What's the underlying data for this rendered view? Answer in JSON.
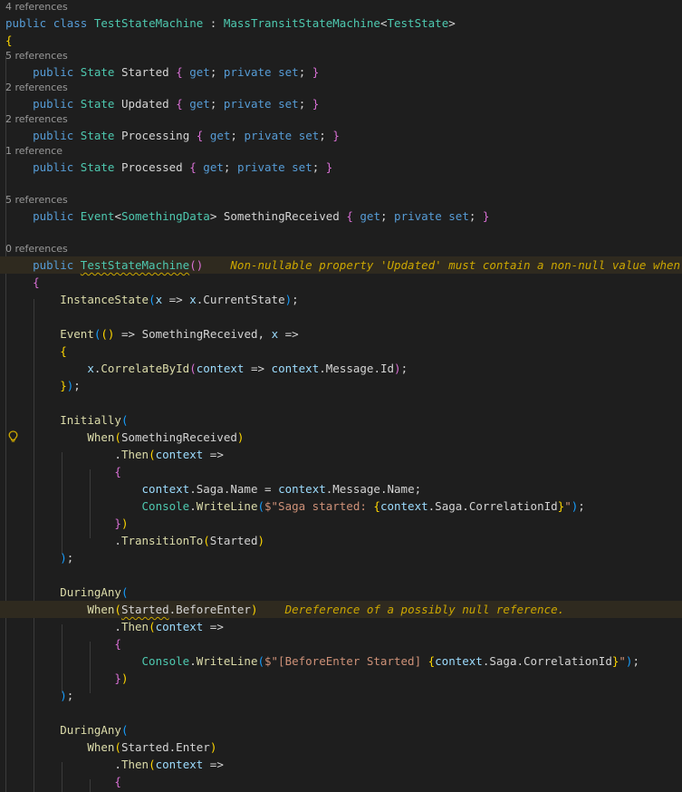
{
  "colors": {
    "keyword": "#569cd6",
    "type": "#4ec9b0",
    "function": "#dcdcaa",
    "variable": "#9cdcfe",
    "control": "#c586c0",
    "string": "#ce9178",
    "default": "#d4d4d4",
    "bracket_gold": "#ffd700",
    "bracket_purple": "#da70d6",
    "bracket_blue": "#179fff",
    "lens": "#999999",
    "warning_text": "#cca700"
  },
  "lightbulb_icon": "lightbulb-icon",
  "lines": [
    {
      "kind": "lens",
      "text": "4 references"
    },
    {
      "kind": "code",
      "tokens": [
        [
          "public",
          "keyword"
        ],
        [
          " ",
          "default"
        ],
        [
          "class",
          "keyword"
        ],
        [
          " ",
          "default"
        ],
        [
          "TestStateMachine",
          "type"
        ],
        [
          " : ",
          "default"
        ],
        [
          "MassTransitStateMachine",
          "type"
        ],
        [
          "<",
          "default"
        ],
        [
          "TestState",
          "type"
        ],
        [
          ">",
          "default"
        ]
      ]
    },
    {
      "kind": "code",
      "tokens": [
        [
          "{",
          "bracket_gold"
        ]
      ]
    },
    {
      "kind": "lens",
      "text": "5 references"
    },
    {
      "kind": "code",
      "tokens": [
        [
          "    ",
          "default"
        ],
        [
          "public",
          "keyword"
        ],
        [
          " ",
          "default"
        ],
        [
          "State",
          "type"
        ],
        [
          " ",
          "default"
        ],
        [
          "Started",
          "default"
        ],
        [
          " ",
          "default"
        ],
        [
          "{",
          "bracket_purple"
        ],
        [
          " ",
          "default"
        ],
        [
          "get",
          "keyword"
        ],
        [
          "; ",
          "default"
        ],
        [
          "private",
          "keyword"
        ],
        [
          " ",
          "default"
        ],
        [
          "set",
          "keyword"
        ],
        [
          "; ",
          "default"
        ],
        [
          "}",
          "bracket_purple"
        ]
      ]
    },
    {
      "kind": "lens",
      "text": "2 references"
    },
    {
      "kind": "code",
      "tokens": [
        [
          "    ",
          "default"
        ],
        [
          "public",
          "keyword"
        ],
        [
          " ",
          "default"
        ],
        [
          "State",
          "type"
        ],
        [
          " ",
          "default"
        ],
        [
          "Updated",
          "default"
        ],
        [
          " ",
          "default"
        ],
        [
          "{",
          "bracket_purple"
        ],
        [
          " ",
          "default"
        ],
        [
          "get",
          "keyword"
        ],
        [
          "; ",
          "default"
        ],
        [
          "private",
          "keyword"
        ],
        [
          " ",
          "default"
        ],
        [
          "set",
          "keyword"
        ],
        [
          "; ",
          "default"
        ],
        [
          "}",
          "bracket_purple"
        ]
      ]
    },
    {
      "kind": "lens",
      "text": "2 references"
    },
    {
      "kind": "code",
      "tokens": [
        [
          "    ",
          "default"
        ],
        [
          "public",
          "keyword"
        ],
        [
          " ",
          "default"
        ],
        [
          "State",
          "type"
        ],
        [
          " ",
          "default"
        ],
        [
          "Processing",
          "default"
        ],
        [
          " ",
          "default"
        ],
        [
          "{",
          "bracket_purple"
        ],
        [
          " ",
          "default"
        ],
        [
          "get",
          "keyword"
        ],
        [
          "; ",
          "default"
        ],
        [
          "private",
          "keyword"
        ],
        [
          " ",
          "default"
        ],
        [
          "set",
          "keyword"
        ],
        [
          "; ",
          "default"
        ],
        [
          "}",
          "bracket_purple"
        ]
      ]
    },
    {
      "kind": "lens",
      "text": "1 reference"
    },
    {
      "kind": "code",
      "tokens": [
        [
          "    ",
          "default"
        ],
        [
          "public",
          "keyword"
        ],
        [
          " ",
          "default"
        ],
        [
          "State",
          "type"
        ],
        [
          " ",
          "default"
        ],
        [
          "Processed",
          "default"
        ],
        [
          " ",
          "default"
        ],
        [
          "{",
          "bracket_purple"
        ],
        [
          " ",
          "default"
        ],
        [
          "get",
          "keyword"
        ],
        [
          "; ",
          "default"
        ],
        [
          "private",
          "keyword"
        ],
        [
          " ",
          "default"
        ],
        [
          "set",
          "keyword"
        ],
        [
          "; ",
          "default"
        ],
        [
          "}",
          "bracket_purple"
        ]
      ]
    },
    {
      "kind": "blank"
    },
    {
      "kind": "lens",
      "text": "5 references"
    },
    {
      "kind": "code",
      "tokens": [
        [
          "    ",
          "default"
        ],
        [
          "public",
          "keyword"
        ],
        [
          " ",
          "default"
        ],
        [
          "Event",
          "type"
        ],
        [
          "<",
          "default"
        ],
        [
          "SomethingData",
          "type"
        ],
        [
          "> ",
          "default"
        ],
        [
          "SomethingReceived",
          "default"
        ],
        [
          " ",
          "default"
        ],
        [
          "{",
          "bracket_purple"
        ],
        [
          " ",
          "default"
        ],
        [
          "get",
          "keyword"
        ],
        [
          "; ",
          "default"
        ],
        [
          "private",
          "keyword"
        ],
        [
          " ",
          "default"
        ],
        [
          "set",
          "keyword"
        ],
        [
          "; ",
          "default"
        ],
        [
          "}",
          "bracket_purple"
        ]
      ]
    },
    {
      "kind": "blank"
    },
    {
      "kind": "lens",
      "text": "0 references"
    },
    {
      "kind": "code",
      "warn": true,
      "tokens": [
        [
          "    ",
          "default"
        ],
        [
          "public",
          "keyword"
        ],
        [
          " ",
          "default"
        ],
        [
          "TestStateMachine",
          "type",
          "squiggle"
        ],
        [
          "()",
          "bracket_purple"
        ],
        [
          "    ",
          "default"
        ],
        [
          "Non-nullable property 'Updated' must contain a non-null value when exiting constructor. Consider declaring the property as nullable.",
          "warning_text",
          "inlay"
        ]
      ]
    },
    {
      "kind": "code",
      "tokens": [
        [
          "    ",
          "default"
        ],
        [
          "{",
          "bracket_purple"
        ]
      ]
    },
    {
      "kind": "code",
      "tokens": [
        [
          "        ",
          "default"
        ],
        [
          "InstanceState",
          "function"
        ],
        [
          "(",
          "bracket_blue"
        ],
        [
          "x",
          "variable"
        ],
        [
          " => ",
          "default"
        ],
        [
          "x",
          "variable"
        ],
        [
          ".",
          "default"
        ],
        [
          "CurrentState",
          "default"
        ],
        [
          ")",
          "bracket_blue"
        ],
        [
          ";",
          "default"
        ]
      ]
    },
    {
      "kind": "blank"
    },
    {
      "kind": "code",
      "tokens": [
        [
          "        ",
          "default"
        ],
        [
          "Event",
          "function"
        ],
        [
          "(",
          "bracket_blue"
        ],
        [
          "()",
          "bracket_gold"
        ],
        [
          " => ",
          "default"
        ],
        [
          "SomethingReceived",
          "default"
        ],
        [
          ", ",
          "default"
        ],
        [
          "x",
          "variable"
        ],
        [
          " =>",
          "default"
        ]
      ]
    },
    {
      "kind": "code",
      "tokens": [
        [
          "        ",
          "default"
        ],
        [
          "{",
          "bracket_gold"
        ]
      ]
    },
    {
      "kind": "code",
      "tokens": [
        [
          "            ",
          "default"
        ],
        [
          "x",
          "variable"
        ],
        [
          ".",
          "default"
        ],
        [
          "CorrelateById",
          "function"
        ],
        [
          "(",
          "bracket_purple"
        ],
        [
          "context",
          "variable"
        ],
        [
          " => ",
          "default"
        ],
        [
          "context",
          "variable"
        ],
        [
          ".",
          "default"
        ],
        [
          "Message",
          "default"
        ],
        [
          ".",
          "default"
        ],
        [
          "Id",
          "default"
        ],
        [
          ")",
          "bracket_purple"
        ],
        [
          ";",
          "default"
        ]
      ]
    },
    {
      "kind": "code",
      "tokens": [
        [
          "        ",
          "default"
        ],
        [
          "}",
          "bracket_gold"
        ],
        [
          ")",
          "bracket_blue"
        ],
        [
          ";",
          "default"
        ]
      ]
    },
    {
      "kind": "blank"
    },
    {
      "kind": "code",
      "tokens": [
        [
          "        ",
          "default"
        ],
        [
          "Initially",
          "function"
        ],
        [
          "(",
          "bracket_blue"
        ]
      ]
    },
    {
      "kind": "code",
      "bulb": true,
      "tokens": [
        [
          "            ",
          "default"
        ],
        [
          "When",
          "function"
        ],
        [
          "(",
          "bracket_gold"
        ],
        [
          "SomethingReceived",
          "default"
        ],
        [
          ")",
          "bracket_gold"
        ]
      ]
    },
    {
      "kind": "code",
      "tokens": [
        [
          "                ",
          "default"
        ],
        [
          ".",
          "default"
        ],
        [
          "Then",
          "function"
        ],
        [
          "(",
          "bracket_gold"
        ],
        [
          "context",
          "variable"
        ],
        [
          " =>",
          "default"
        ]
      ]
    },
    {
      "kind": "code",
      "tokens": [
        [
          "                ",
          "default"
        ],
        [
          "{",
          "bracket_purple"
        ]
      ]
    },
    {
      "kind": "code",
      "tokens": [
        [
          "                    ",
          "default"
        ],
        [
          "context",
          "variable"
        ],
        [
          ".",
          "default"
        ],
        [
          "Saga",
          "default"
        ],
        [
          ".",
          "default"
        ],
        [
          "Name",
          "default"
        ],
        [
          " = ",
          "default"
        ],
        [
          "context",
          "variable"
        ],
        [
          ".",
          "default"
        ],
        [
          "Message",
          "default"
        ],
        [
          ".",
          "default"
        ],
        [
          "Name",
          "default"
        ],
        [
          ";",
          "default"
        ]
      ]
    },
    {
      "kind": "code",
      "tokens": [
        [
          "                    ",
          "default"
        ],
        [
          "Console",
          "type"
        ],
        [
          ".",
          "default"
        ],
        [
          "WriteLine",
          "function"
        ],
        [
          "(",
          "bracket_blue"
        ],
        [
          "$\"Saga started: ",
          "string"
        ],
        [
          "{",
          "bracket_gold"
        ],
        [
          "context",
          "variable"
        ],
        [
          ".",
          "default"
        ],
        [
          "Saga",
          "default"
        ],
        [
          ".",
          "default"
        ],
        [
          "CorrelationId",
          "default"
        ],
        [
          "}",
          "bracket_gold"
        ],
        [
          "\"",
          "string"
        ],
        [
          ")",
          "bracket_blue"
        ],
        [
          ";",
          "default"
        ]
      ]
    },
    {
      "kind": "code",
      "tokens": [
        [
          "                ",
          "default"
        ],
        [
          "}",
          "bracket_purple"
        ],
        [
          ")",
          "bracket_gold"
        ]
      ]
    },
    {
      "kind": "code",
      "tokens": [
        [
          "                ",
          "default"
        ],
        [
          ".",
          "default"
        ],
        [
          "TransitionTo",
          "function"
        ],
        [
          "(",
          "bracket_gold"
        ],
        [
          "Started",
          "default"
        ],
        [
          ")",
          "bracket_gold"
        ]
      ]
    },
    {
      "kind": "code",
      "tokens": [
        [
          "        ",
          "default"
        ],
        [
          ")",
          "bracket_blue"
        ],
        [
          ";",
          "default"
        ]
      ]
    },
    {
      "kind": "blank"
    },
    {
      "kind": "code",
      "tokens": [
        [
          "        ",
          "default"
        ],
        [
          "DuringAny",
          "function"
        ],
        [
          "(",
          "bracket_blue"
        ]
      ]
    },
    {
      "kind": "code",
      "warn": true,
      "tokens": [
        [
          "            ",
          "default"
        ],
        [
          "When",
          "function"
        ],
        [
          "(",
          "bracket_gold"
        ],
        [
          "Started",
          "default",
          "squiggle"
        ],
        [
          ".",
          "default"
        ],
        [
          "BeforeEnter",
          "default"
        ],
        [
          ")",
          "bracket_gold"
        ],
        [
          "    ",
          "default"
        ],
        [
          "Dereference of a possibly null reference.",
          "warning_text",
          "inlay"
        ]
      ]
    },
    {
      "kind": "code",
      "tokens": [
        [
          "                ",
          "default"
        ],
        [
          ".",
          "default"
        ],
        [
          "Then",
          "function"
        ],
        [
          "(",
          "bracket_gold"
        ],
        [
          "context",
          "variable"
        ],
        [
          " =>",
          "default"
        ]
      ]
    },
    {
      "kind": "code",
      "tokens": [
        [
          "                ",
          "default"
        ],
        [
          "{",
          "bracket_purple"
        ]
      ]
    },
    {
      "kind": "code",
      "tokens": [
        [
          "                    ",
          "default"
        ],
        [
          "Console",
          "type"
        ],
        [
          ".",
          "default"
        ],
        [
          "WriteLine",
          "function"
        ],
        [
          "(",
          "bracket_blue"
        ],
        [
          "$\"[BeforeEnter Started] ",
          "string"
        ],
        [
          "{",
          "bracket_gold"
        ],
        [
          "context",
          "variable"
        ],
        [
          ".",
          "default"
        ],
        [
          "Saga",
          "default"
        ],
        [
          ".",
          "default"
        ],
        [
          "CorrelationId",
          "default"
        ],
        [
          "}",
          "bracket_gold"
        ],
        [
          "\"",
          "string"
        ],
        [
          ")",
          "bracket_blue"
        ],
        [
          ";",
          "default"
        ]
      ]
    },
    {
      "kind": "code",
      "tokens": [
        [
          "                ",
          "default"
        ],
        [
          "}",
          "bracket_purple"
        ],
        [
          ")",
          "bracket_gold"
        ]
      ]
    },
    {
      "kind": "code",
      "tokens": [
        [
          "        ",
          "default"
        ],
        [
          ")",
          "bracket_blue"
        ],
        [
          ";",
          "default"
        ]
      ]
    },
    {
      "kind": "blank"
    },
    {
      "kind": "code",
      "tokens": [
        [
          "        ",
          "default"
        ],
        [
          "DuringAny",
          "function"
        ],
        [
          "(",
          "bracket_blue"
        ]
      ]
    },
    {
      "kind": "code",
      "tokens": [
        [
          "            ",
          "default"
        ],
        [
          "When",
          "function"
        ],
        [
          "(",
          "bracket_gold"
        ],
        [
          "Started",
          "default"
        ],
        [
          ".",
          "default"
        ],
        [
          "Enter",
          "default"
        ],
        [
          ")",
          "bracket_gold"
        ]
      ]
    },
    {
      "kind": "code",
      "tokens": [
        [
          "                ",
          "default"
        ],
        [
          ".",
          "default"
        ],
        [
          "Then",
          "function"
        ],
        [
          "(",
          "bracket_gold"
        ],
        [
          "context",
          "variable"
        ],
        [
          " =>",
          "default"
        ]
      ]
    },
    {
      "kind": "code",
      "tokens": [
        [
          "                ",
          "default"
        ],
        [
          "{",
          "bracket_purple"
        ]
      ]
    }
  ]
}
